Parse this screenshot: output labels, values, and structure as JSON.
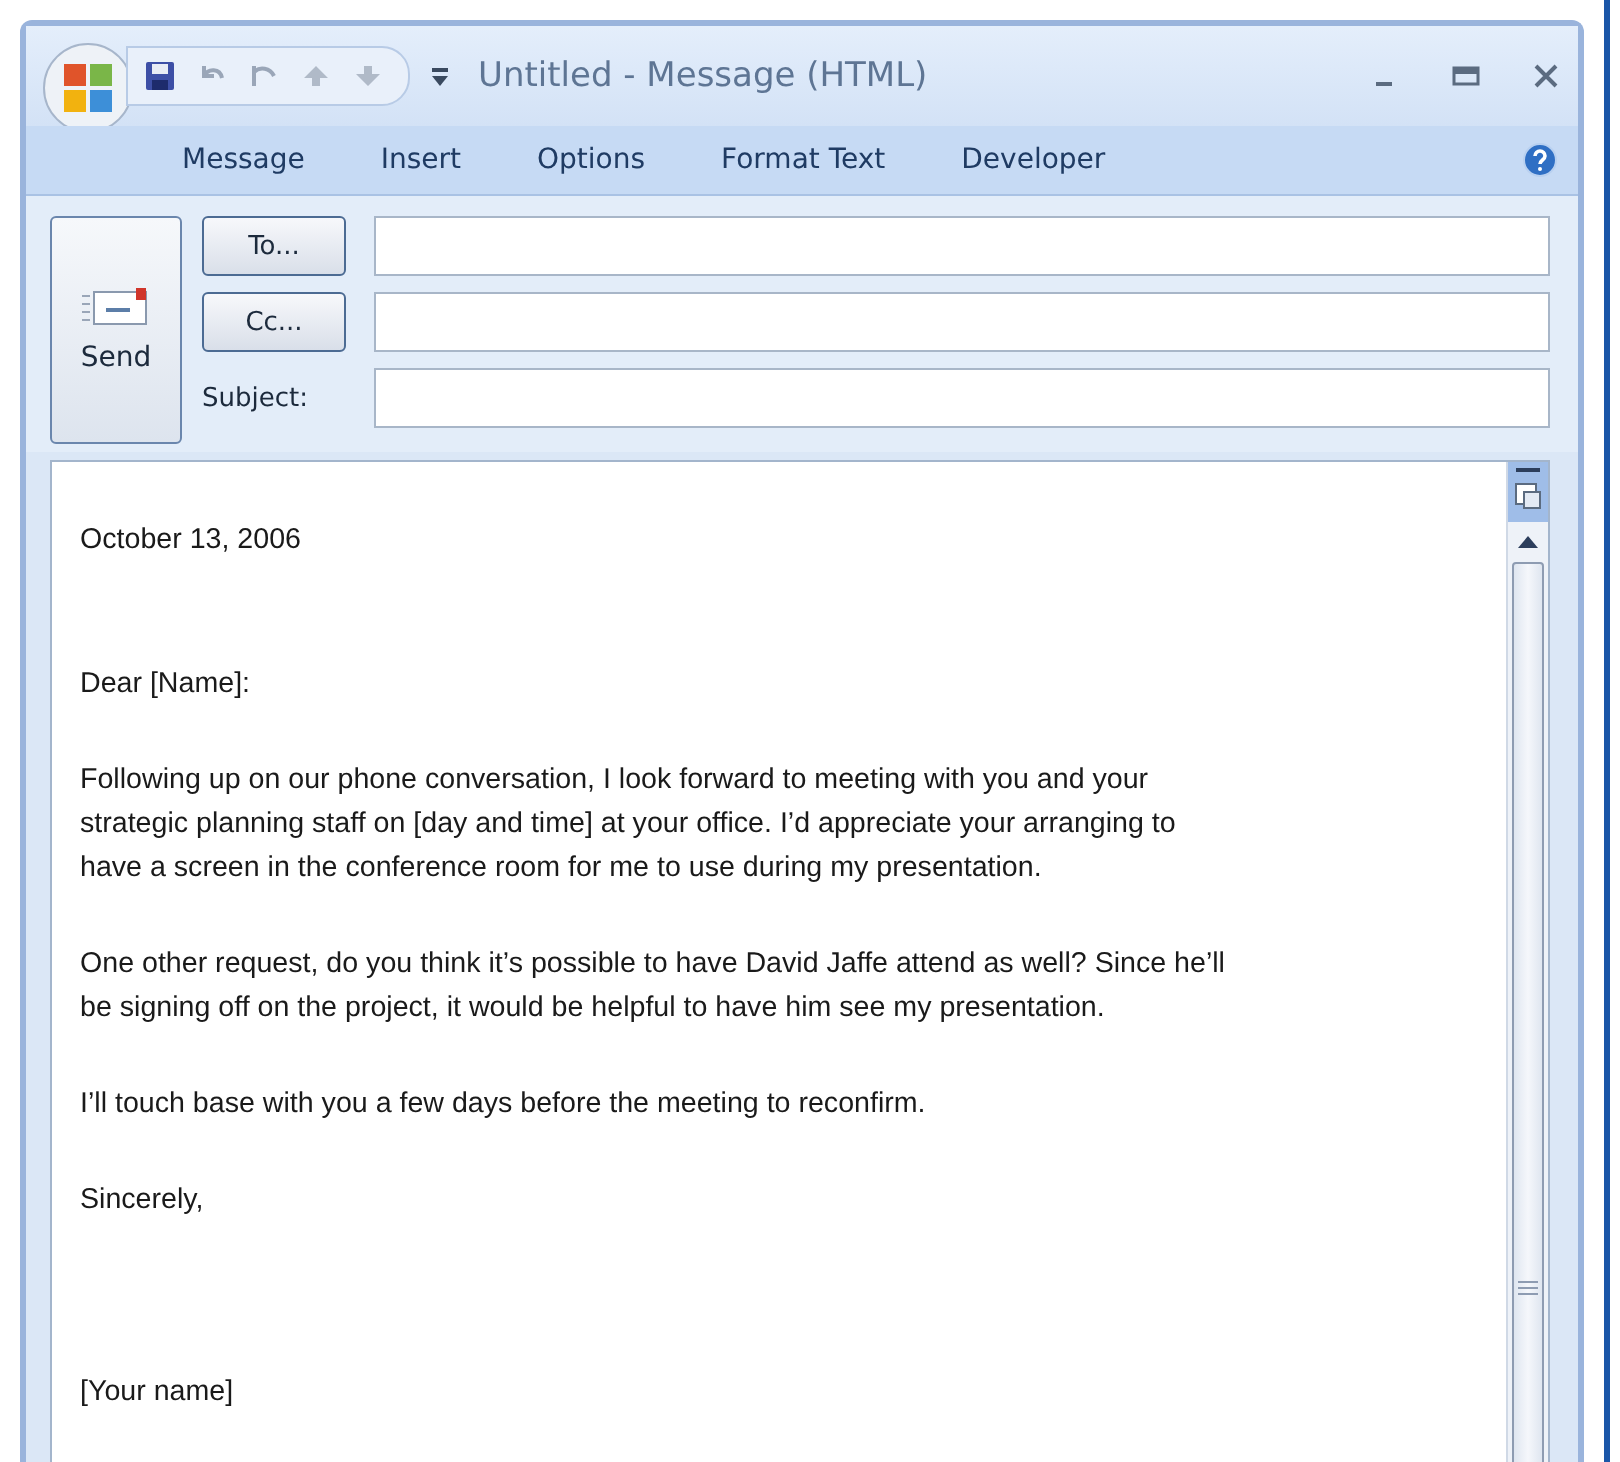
{
  "window": {
    "title": "Untitled - Message (HTML)"
  },
  "ribbon_tabs": [
    {
      "label": "Message"
    },
    {
      "label": "Insert"
    },
    {
      "label": "Options"
    },
    {
      "label": "Format Text"
    },
    {
      "label": "Developer"
    }
  ],
  "header": {
    "send_label": "Send",
    "to_label": "To...",
    "cc_label": "Cc...",
    "subject_label": "Subject:"
  },
  "body": {
    "date": "October 13, 2006",
    "greeting": "Dear [Name]:",
    "paragraphs": [
      {
        "lines": [
          "Following up on our phone conversation, I look forward to meeting with you and your",
          "strategic planning staff on [day and time] at your office. I’d appreciate your arranging to",
          "have a screen in the conference room for me to use during my presentation."
        ]
      },
      {
        "lines": [
          "One other request, do you think it’s possible to have David Jaffe attend as well? Since he’ll",
          "be signing off on the project, it would be helpful to have him see my presentation."
        ]
      },
      {
        "lines": [
          "I’ll touch base with you a few days before the meeting to reconfirm."
        ]
      }
    ],
    "closing": "Sincerely,",
    "signature": "[Your name]"
  }
}
